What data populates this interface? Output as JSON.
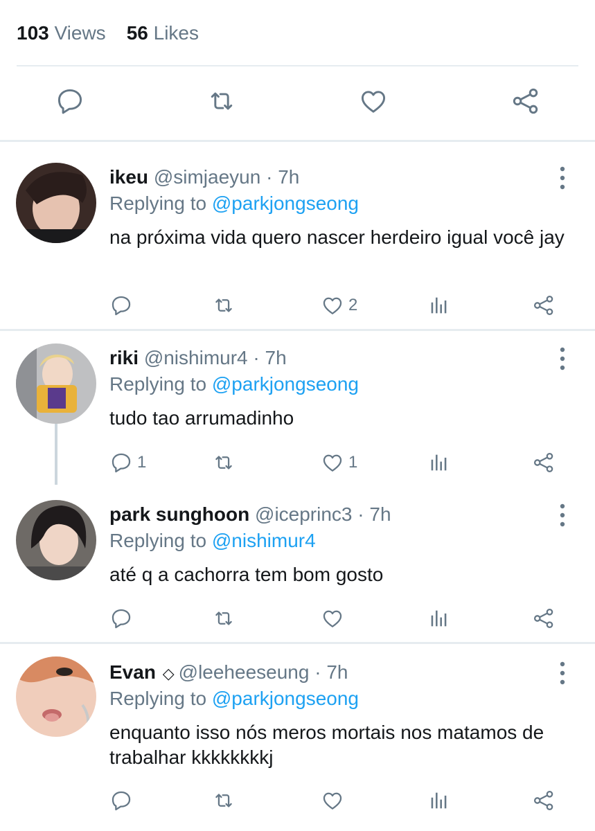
{
  "stats": {
    "views_count": "103",
    "views_label": "Views",
    "likes_count": "56",
    "likes_label": "Likes"
  },
  "colors": {
    "link": "#1da1f2",
    "muted": "#657786",
    "icon": "#657786",
    "main_icon": "#657786",
    "divider": "#e6ecf0"
  },
  "main_actions": [
    "reply-icon",
    "retweet-icon",
    "like-icon",
    "share-icon"
  ],
  "replies": [
    {
      "name": "ikeu",
      "handle": "@simjaeyun",
      "time": "7h",
      "replying_prefix": "Replying to",
      "replying_to": "@parkjongseong",
      "text": "na próxima vida quero nascer herdeiro igual você jay",
      "reply_count": "",
      "retweet_count": "",
      "like_count": "2"
    },
    {
      "name": "riki",
      "handle": "@nishimur4",
      "time": "7h",
      "replying_prefix": "Replying to",
      "replying_to": "@parkjongseong",
      "text": "tudo tao arrumadinho",
      "reply_count": "1",
      "retweet_count": "",
      "like_count": "1"
    },
    {
      "name": "park sunghoon",
      "handle": "@iceprinc3",
      "time": "7h",
      "replying_prefix": "Replying to",
      "replying_to": "@nishimur4",
      "text": "até q a cachorra tem bom gosto",
      "reply_count": "",
      "retweet_count": "",
      "like_count": ""
    },
    {
      "name": "Evan",
      "badge": "◇",
      "handle": "@leeheeseung",
      "time": "7h",
      "replying_prefix": "Replying to",
      "replying_to": "@parkjongseong",
      "text": "enquanto isso nós meros mortais nos matamos de trabalhar kkkkkkkkj",
      "reply_count": "",
      "retweet_count": "",
      "like_count": ""
    }
  ]
}
